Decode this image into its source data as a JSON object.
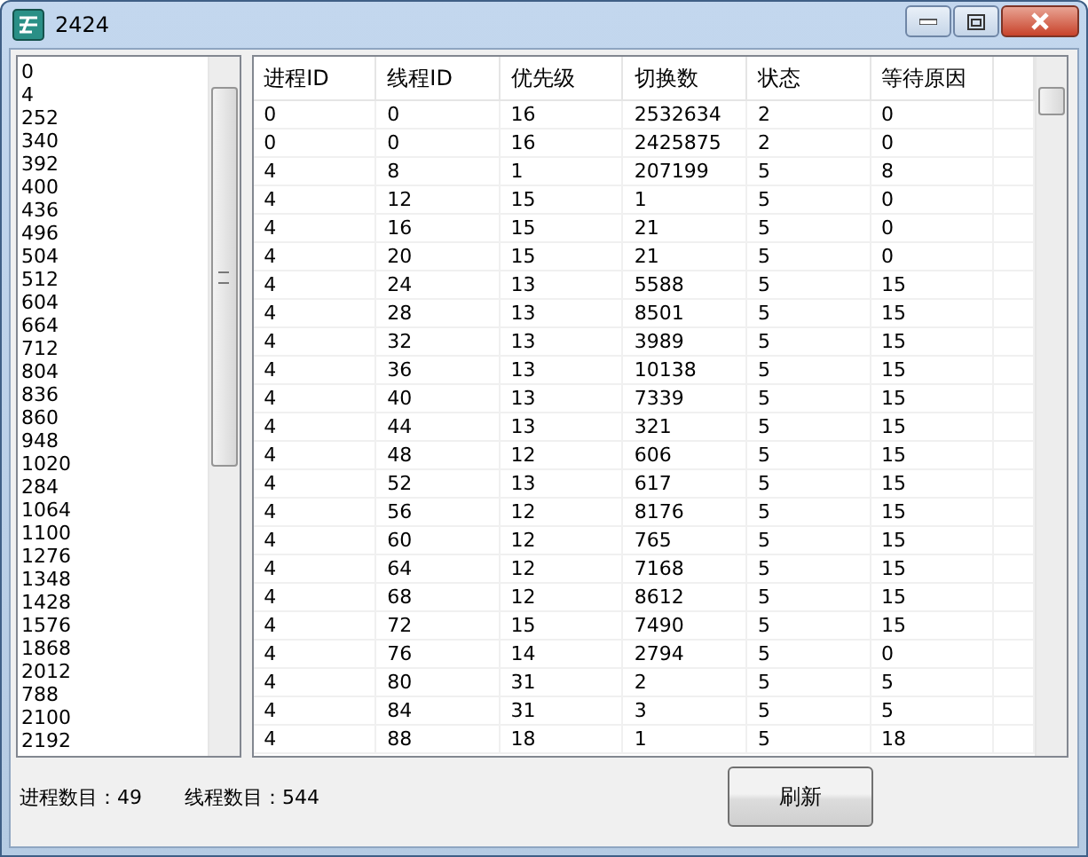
{
  "window": {
    "title": "2424"
  },
  "process_list": {
    "items": [
      "0",
      "4",
      "252",
      "340",
      "392",
      "400",
      "436",
      "496",
      "504",
      "512",
      "604",
      "664",
      "712",
      "804",
      "836",
      "860",
      "948",
      "1020",
      "284",
      "1064",
      "1100",
      "1276",
      "1348",
      "1428",
      "1576",
      "1868",
      "2012",
      "788",
      "2100",
      "2192"
    ]
  },
  "thread_table": {
    "columns": [
      "进程ID",
      "线程ID",
      "优先级",
      "切换数",
      "状态",
      "等待原因"
    ],
    "rows": [
      [
        "0",
        "0",
        "16",
        "2532634",
        "2",
        "0"
      ],
      [
        "0",
        "0",
        "16",
        "2425875",
        "2",
        "0"
      ],
      [
        "4",
        "8",
        "1",
        "207199",
        "5",
        "8"
      ],
      [
        "4",
        "12",
        "15",
        "1",
        "5",
        "0"
      ],
      [
        "4",
        "16",
        "15",
        "21",
        "5",
        "0"
      ],
      [
        "4",
        "20",
        "15",
        "21",
        "5",
        "0"
      ],
      [
        "4",
        "24",
        "13",
        "5588",
        "5",
        "15"
      ],
      [
        "4",
        "28",
        "13",
        "8501",
        "5",
        "15"
      ],
      [
        "4",
        "32",
        "13",
        "3989",
        "5",
        "15"
      ],
      [
        "4",
        "36",
        "13",
        "10138",
        "5",
        "15"
      ],
      [
        "4",
        "40",
        "13",
        "7339",
        "5",
        "15"
      ],
      [
        "4",
        "44",
        "13",
        "321",
        "5",
        "15"
      ],
      [
        "4",
        "48",
        "12",
        "606",
        "5",
        "15"
      ],
      [
        "4",
        "52",
        "13",
        "617",
        "5",
        "15"
      ],
      [
        "4",
        "56",
        "12",
        "8176",
        "5",
        "15"
      ],
      [
        "4",
        "60",
        "12",
        "765",
        "5",
        "15"
      ],
      [
        "4",
        "64",
        "12",
        "7168",
        "5",
        "15"
      ],
      [
        "4",
        "68",
        "12",
        "8612",
        "5",
        "15"
      ],
      [
        "4",
        "72",
        "15",
        "7490",
        "5",
        "15"
      ],
      [
        "4",
        "76",
        "14",
        "2794",
        "5",
        "0"
      ],
      [
        "4",
        "80",
        "31",
        "2",
        "5",
        "5"
      ],
      [
        "4",
        "84",
        "31",
        "3",
        "5",
        "5"
      ],
      [
        "4",
        "88",
        "18",
        "1",
        "5",
        "18"
      ]
    ]
  },
  "status": {
    "process_count": "进程数目：49",
    "thread_count": "线程数目：544"
  },
  "buttons": [
    "刷新"
  ]
}
